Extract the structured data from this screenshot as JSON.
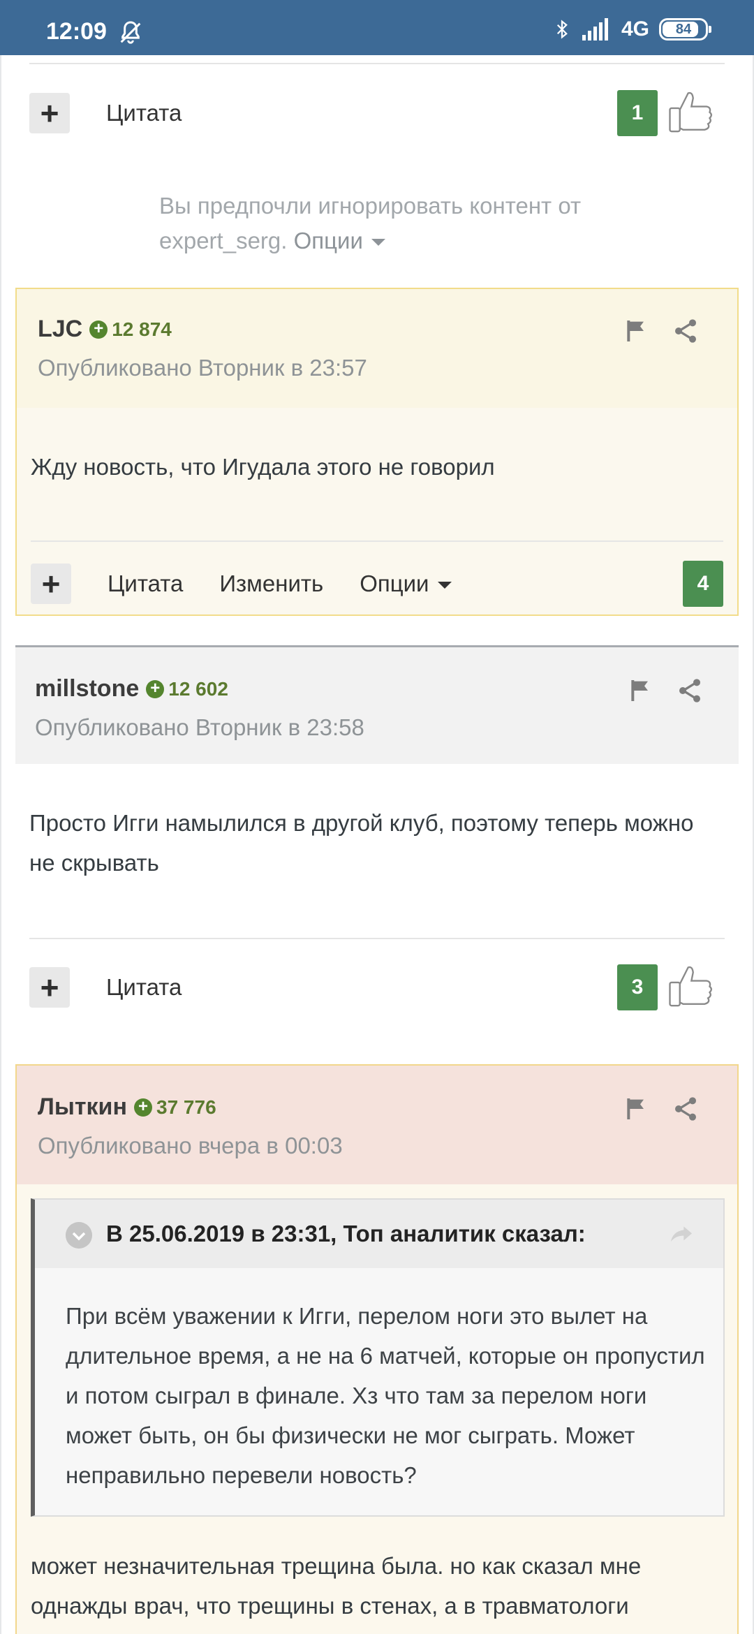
{
  "status_bar": {
    "time": "12:09",
    "network": "4G",
    "battery": "84"
  },
  "top_actions": {
    "plus": "+",
    "quote_label": "Цитата",
    "score": "1"
  },
  "ignored_notice": {
    "text": "Вы предпочли игнорировать контент от expert_serg.",
    "options_label": "Опции"
  },
  "posts": [
    {
      "author": "LJC",
      "rep_sign": "+",
      "rep": "12 874",
      "published": "Опубликовано Вторник в 23:57",
      "text": "Жду новость, что Игудала этого не говорил",
      "actions": {
        "plus": "+",
        "quote_label": "Цитата",
        "edit_label": "Изменить",
        "options_label": "Опции",
        "score": "4"
      }
    },
    {
      "author": "millstone",
      "rep_sign": "+",
      "rep": "12 602",
      "published": "Опубликовано Вторник в 23:58",
      "text": "Просто Игги намылился в другой клуб, поэтому теперь можно не скрывать",
      "actions": {
        "plus": "+",
        "quote_label": "Цитата",
        "score": "3"
      }
    },
    {
      "author": "Лыткин",
      "rep_sign": "+",
      "rep": "37 776",
      "published": "Опубликовано вчера в 00:03",
      "quote": {
        "title": "В 25.06.2019 в 23:31, Топ аналитик сказал:",
        "text": "При всём уважении к Игги, перелом ноги это вылет на длительное время, а не на 6 матчей, которые он пропустил и потом сыграл в финале. Хз что там за перелом ноги может быть, он бы физически не мог сыграть. Может неправильно перевели новость?"
      },
      "text": "может незначительная трещина была. но как сказал мне однажды врач, что трещины в стенах, а в травматологи"
    }
  ],
  "colors": {
    "status_bar": "#3d6a96",
    "score_green": "#4b8f51",
    "rep_green": "#54852e",
    "post_yellow": "#faf6e4",
    "post_pink": "#f5e2dc"
  }
}
